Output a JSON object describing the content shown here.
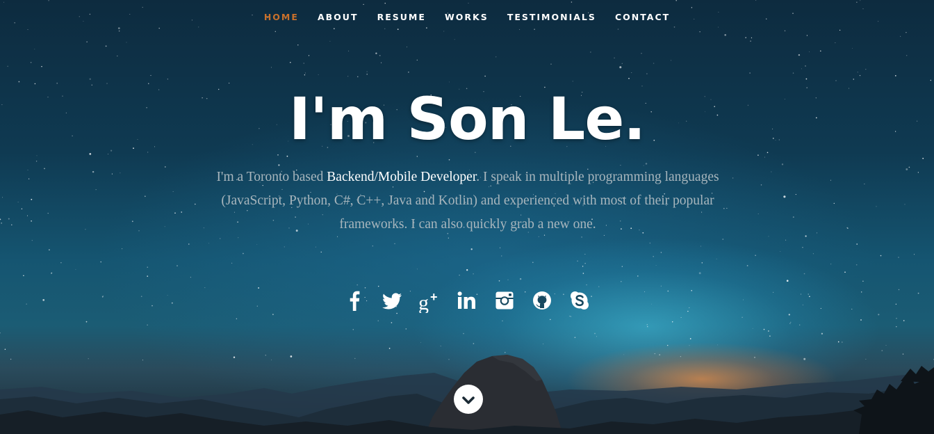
{
  "nav": {
    "items": [
      {
        "label": "HOME",
        "active": true
      },
      {
        "label": "ABOUT",
        "active": false
      },
      {
        "label": "RESUME",
        "active": false
      },
      {
        "label": "WORKS",
        "active": false
      },
      {
        "label": "TESTIMONIALS",
        "active": false
      },
      {
        "label": "CONTACT",
        "active": false
      }
    ]
  },
  "hero": {
    "title": "I'm Son Le.",
    "intro_before": "I'm a Toronto based ",
    "intro_role": "Backend/Mobile Developer",
    "intro_after": ". I speak in multiple programming languages (JavaScript, Python, C#, C++, Java and Kotlin) and experienced with most of their popular frameworks. I can also quickly grab a new one."
  },
  "social": [
    {
      "icon": "facebook-icon"
    },
    {
      "icon": "twitter-icon"
    },
    {
      "icon": "google-plus-icon"
    },
    {
      "icon": "linkedin-icon"
    },
    {
      "icon": "instagram-icon"
    },
    {
      "icon": "github-icon"
    },
    {
      "icon": "skype-icon"
    }
  ],
  "scroll_down": {
    "icon": "chevron-down-icon"
  },
  "colors": {
    "accent": "#c8702b",
    "text_light": "#ffffff",
    "text_muted": "#a8b6bd",
    "sky_top": "#0d2b3f",
    "sky_glow": "#46c8e6",
    "horizon_glow": "#e88c46"
  }
}
